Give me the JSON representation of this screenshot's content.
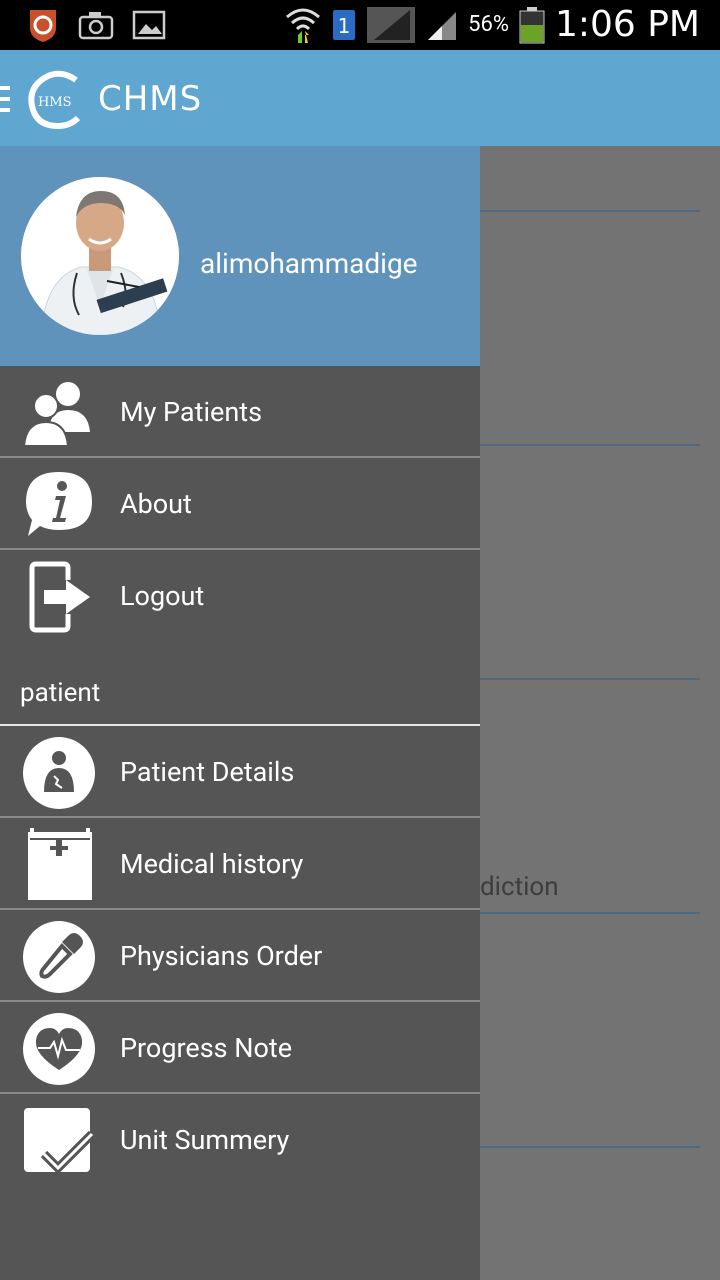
{
  "status_bar": {
    "battery_percent": "56%",
    "time": "1:06 PM",
    "sim_label": "1"
  },
  "app_bar": {
    "logo_letters": "HMS",
    "title": "CHMS"
  },
  "drawer": {
    "username": "alimohammadige",
    "items_top": [
      {
        "label": "My Patients",
        "icon": "patients-icon"
      },
      {
        "label": "About",
        "icon": "info-icon"
      },
      {
        "label": "Logout",
        "icon": "logout-icon"
      }
    ],
    "section_label": "patient",
    "items_patient": [
      {
        "label": "Patient Details",
        "icon": "patient-icon"
      },
      {
        "label": "Medical history",
        "icon": "clipboard-icon"
      },
      {
        "label": "Physicians Order",
        "icon": "dropper-icon"
      },
      {
        "label": "Progress Note",
        "icon": "heart-icon"
      },
      {
        "label": "Unit Summery",
        "icon": "checkbox-icon"
      }
    ]
  },
  "background": {
    "partial_text": "diction"
  },
  "colors": {
    "app_bar": "#5fa6d0",
    "drawer_header": "#5f93bb",
    "drawer_bg": "#555555"
  }
}
